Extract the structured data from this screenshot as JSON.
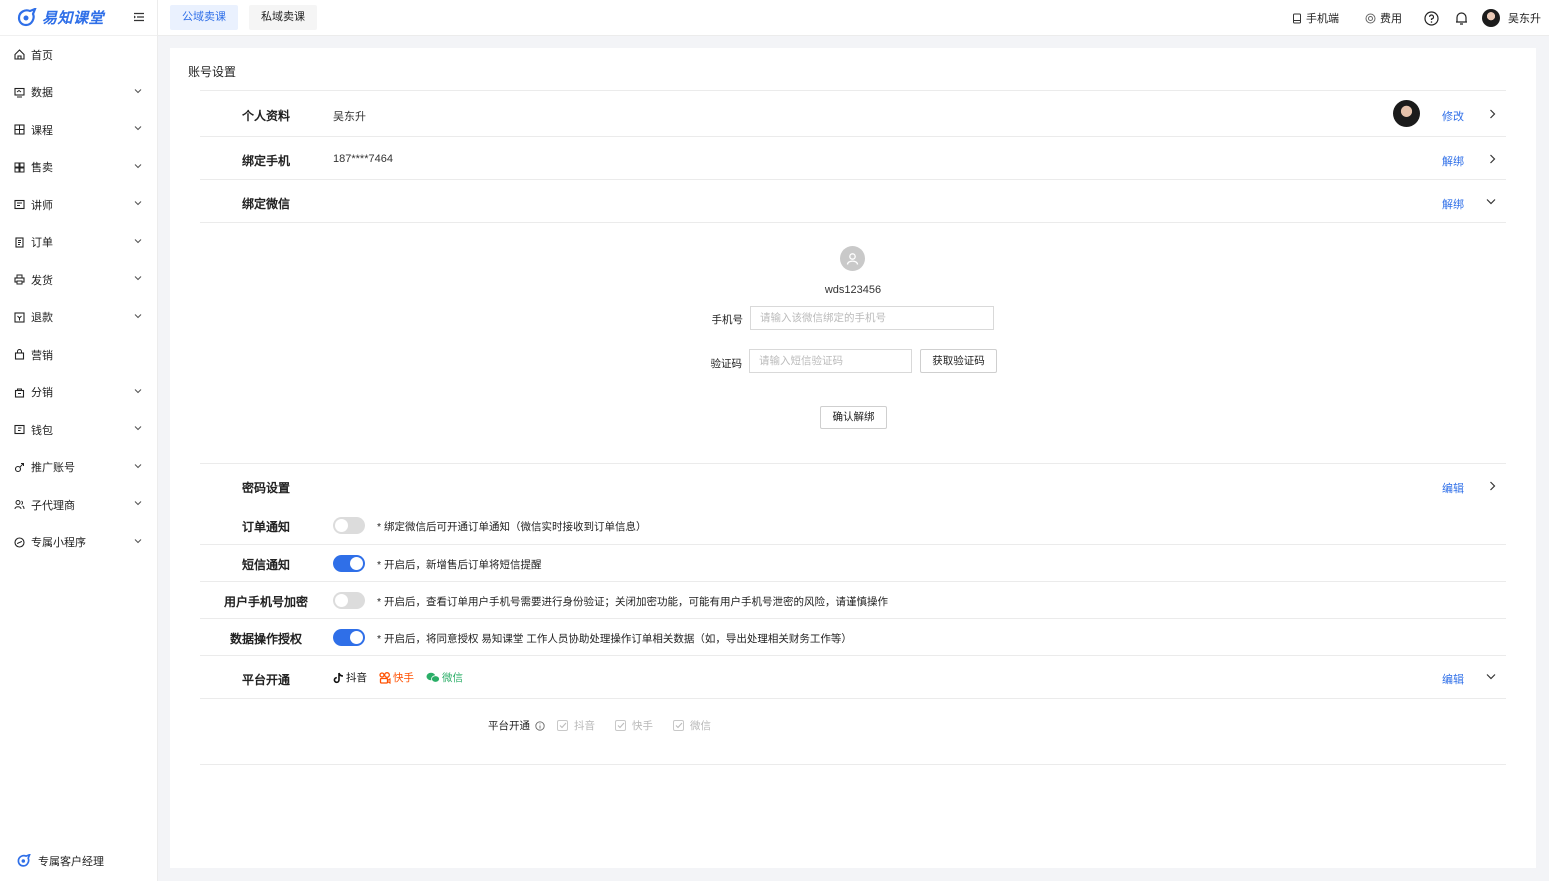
{
  "brand": {
    "name": "易知课堂"
  },
  "sidebar": {
    "items": [
      {
        "label": "首页",
        "icon": "home-icon",
        "expandable": false
      },
      {
        "label": "数据",
        "icon": "monitor-icon",
        "expandable": true
      },
      {
        "label": "课程",
        "icon": "grid-icon",
        "expandable": true
      },
      {
        "label": "售卖",
        "icon": "shop-icon",
        "expandable": true
      },
      {
        "label": "讲师",
        "icon": "teacher-icon",
        "expandable": true
      },
      {
        "label": "订单",
        "icon": "order-icon",
        "expandable": true
      },
      {
        "label": "发货",
        "icon": "printer-icon",
        "expandable": true
      },
      {
        "label": "退款",
        "icon": "refund-icon",
        "expandable": true
      },
      {
        "label": "营销",
        "icon": "bag-icon",
        "expandable": false
      },
      {
        "label": "分销",
        "icon": "share-bag-icon",
        "expandable": true
      },
      {
        "label": "钱包",
        "icon": "wallet-icon",
        "expandable": true
      },
      {
        "label": "推广账号",
        "icon": "promote-icon",
        "expandable": true
      },
      {
        "label": "子代理商",
        "icon": "agent-icon",
        "expandable": true
      },
      {
        "label": "专属小程序",
        "icon": "miniapp-icon",
        "expandable": true
      }
    ],
    "manager_label": "专属客户经理"
  },
  "topbar": {
    "tabs": [
      {
        "label": "公域卖课",
        "active": true
      },
      {
        "label": "私域卖课",
        "active": false
      }
    ],
    "mobile_label": "手机端",
    "fee_label": "费用",
    "user_name": "吴东升"
  },
  "settings": {
    "title": "账号设置",
    "profile": {
      "label": "个人资料",
      "value": "吴东升",
      "action": "修改"
    },
    "phone": {
      "label": "绑定手机",
      "value": "187****7464",
      "action": "解绑"
    },
    "wechat": {
      "label": "绑定微信",
      "action": "解绑",
      "nickname": "wds123456",
      "phone_label": "手机号",
      "phone_placeholder": "请输入该微信绑定的手机号",
      "code_label": "验证码",
      "code_placeholder": "请输入短信验证码",
      "get_code_button": "获取验证码",
      "confirm_button": "确认解绑"
    },
    "password": {
      "label": "密码设置",
      "action": "编辑"
    },
    "order_notify": {
      "label": "订单通知",
      "on": false,
      "desc": "* 绑定微信后可开通订单通知（微信实时接收到订单信息）"
    },
    "sms_notify": {
      "label": "短信通知",
      "on": true,
      "desc": "* 开启后，新增售后订单将短信提醒"
    },
    "phone_encrypt": {
      "label": "用户手机号加密",
      "on": false,
      "desc": "* 开启后，查看订单用户手机号需要进行身份验证；关闭加密功能，可能有用户手机号泄密的风险，请谨慎操作"
    },
    "data_auth": {
      "label": "数据操作授权",
      "on": true,
      "desc": "* 开启后，将同意授权 易知课堂 工作人员协助处理操作订单相关数据（如，导出处理相关财务工作等）"
    },
    "platform": {
      "label": "平台开通",
      "action": "编辑",
      "icons": [
        {
          "label": "抖音",
          "color": "#111111"
        },
        {
          "label": "快手",
          "color": "#ff5000"
        },
        {
          "label": "微信",
          "color": "#2aae67"
        }
      ],
      "options_label": "平台开通",
      "options": [
        "抖音",
        "快手",
        "微信"
      ]
    }
  },
  "colors": {
    "accent": "#2f6fe8",
    "toggle_off": "#dcdcdc"
  }
}
